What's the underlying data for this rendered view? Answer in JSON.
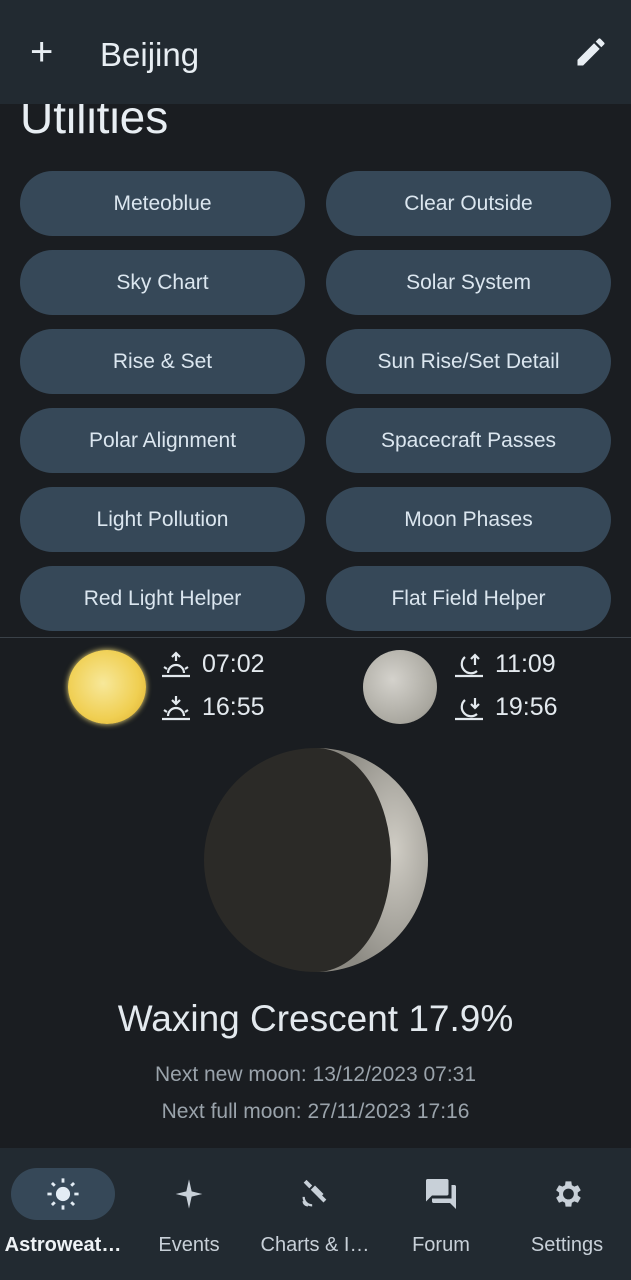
{
  "header": {
    "title": "Beijing",
    "add_icon": "plus-icon",
    "edit_icon": "pencil-icon"
  },
  "section_title": "Utilities",
  "utilities": [
    "Meteoblue",
    "Clear Outside",
    "Sky Chart",
    "Solar System",
    "Rise & Set",
    "Sun Rise/Set Detail",
    "Polar Alignment",
    "Spacecraft Passes",
    "Light Pollution",
    "Moon Phases",
    "Red Light Helper",
    "Flat Field Helper"
  ],
  "sun": {
    "rise": "07:02",
    "set": "16:55"
  },
  "moon": {
    "rise": "11:09",
    "set": "19:56",
    "phase": "Waxing Crescent 17.9%",
    "illumination_percent": 17.9,
    "next_new": "Next new moon: 13/12/2023 07:31",
    "next_full": "Next full moon: 27/11/2023 17:16"
  },
  "nav": [
    {
      "label": "Astroweat…",
      "icon": "sun-icon",
      "active": true
    },
    {
      "label": "Events",
      "icon": "sparkle-icon"
    },
    {
      "label": "Charts & I…",
      "icon": "satellite-icon"
    },
    {
      "label": "Forum",
      "icon": "forum-icon"
    },
    {
      "label": "Settings",
      "icon": "gear-icon"
    }
  ],
  "colors": {
    "background": "#1a1d21",
    "bar": "#222a31",
    "button": "#364858"
  }
}
